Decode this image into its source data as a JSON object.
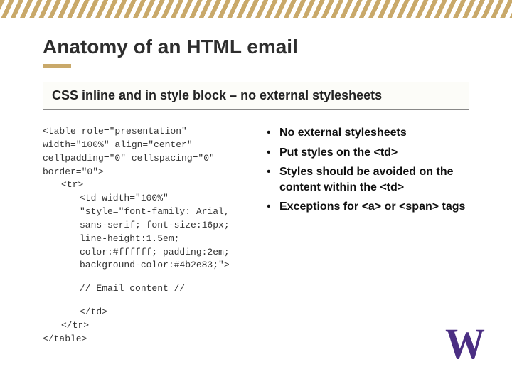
{
  "title": "Anatomy of an HTML email",
  "subtitle": "CSS inline and in style block – no external stylesheets",
  "code": {
    "line1": "<table role=\"presentation\" width=\"100%\" align=\"center\" cellpadding=\"0\" cellspacing=\"0\" border=\"0\">",
    "line2": "<tr>",
    "line3": "<td width=\"100%\" \"style=\"font-family: Arial, sans-serif; font-size:16px; line-height:1.5em; color:#ffffff; padding:2em; background-color:#4b2e83;\">",
    "comment": "// Email content //",
    "line4": "</td>",
    "line5": "</tr>",
    "line6": "</table>"
  },
  "bullets": {
    "b1a": "No external stylesheets",
    "b2a": "Put styles on the <td>",
    "b3a": "Styles should be avoided on the content within the <td>",
    "b4a": "Exceptions for <a> or <span> tags"
  },
  "logo": "W"
}
